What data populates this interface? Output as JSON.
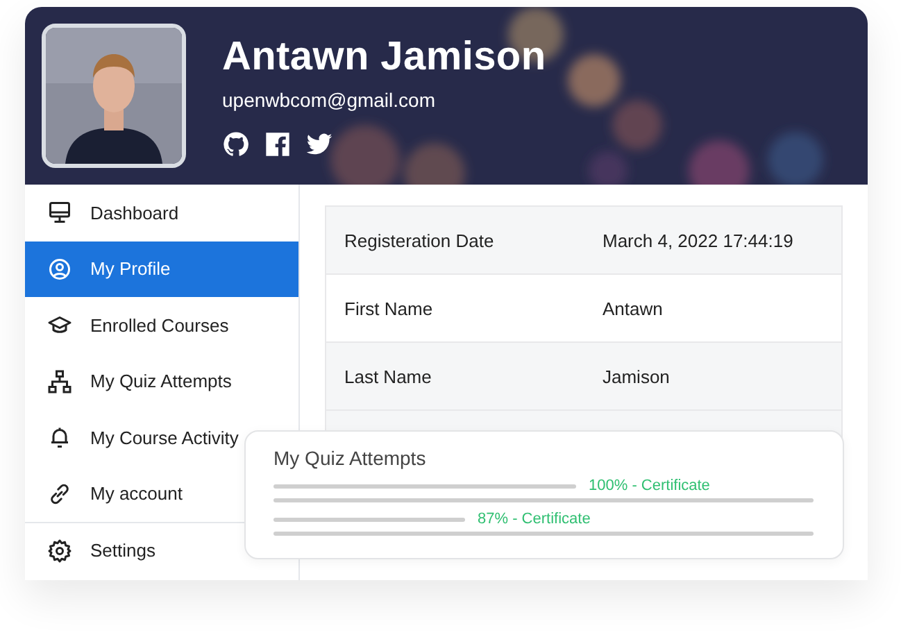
{
  "profile": {
    "name": "Antawn Jamison",
    "email": "upenwbcom@gmail.com",
    "social": [
      {
        "kind": "github"
      },
      {
        "kind": "facebook"
      },
      {
        "kind": "twitter"
      }
    ]
  },
  "sidebar": {
    "items": [
      {
        "label": "Dashboard",
        "selected": false
      },
      {
        "label": "My Profile",
        "selected": true
      },
      {
        "label": "Enrolled Courses",
        "selected": false
      },
      {
        "label": "My Quiz Attempts",
        "selected": false
      },
      {
        "label": "My Course Activity",
        "selected": false
      },
      {
        "label": "My account",
        "selected": false
      },
      {
        "label": "Settings",
        "selected": false
      }
    ]
  },
  "details": {
    "rows": [
      {
        "label": "Registeration Date",
        "value": "March 4, 2022 17:44:19"
      },
      {
        "label": "First Name",
        "value": "Antawn"
      },
      {
        "label": "Last Name",
        "value": "Jamison"
      }
    ]
  },
  "quiz_card": {
    "title": "My Quiz Attempts",
    "attempts": [
      {
        "result": "100% - Certificate"
      },
      {
        "result": "87% - Certificate"
      }
    ]
  }
}
